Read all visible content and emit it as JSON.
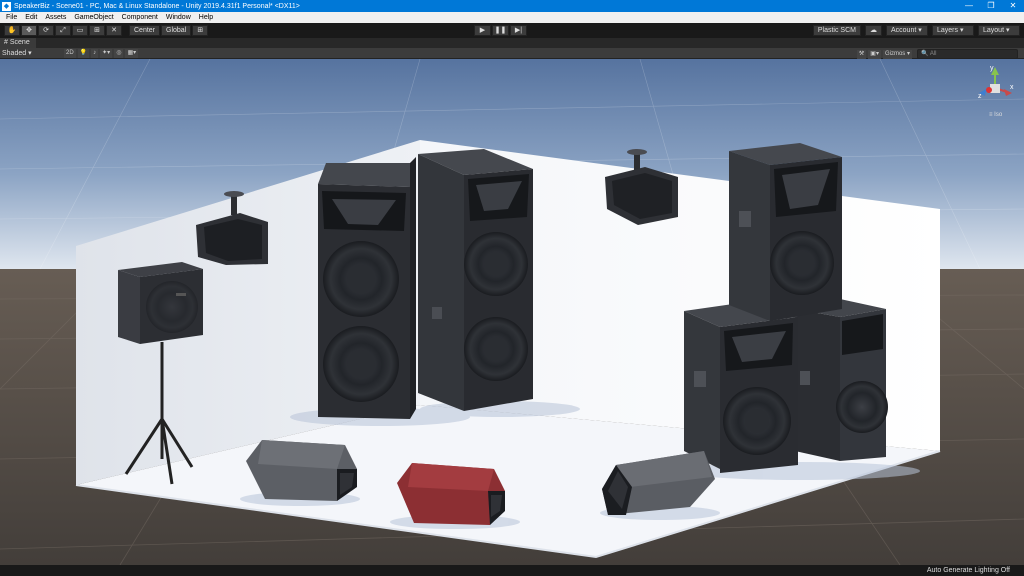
{
  "window": {
    "title": "SpeakerBiz - Scene01 - PC, Mac & Linux Standalone - Unity 2019.4.31f1 Personal* <DX11>",
    "controls": [
      "—",
      "❐",
      "✕"
    ]
  },
  "menu": [
    "File",
    "Edit",
    "Assets",
    "GameObject",
    "Component",
    "Window",
    "Help"
  ],
  "toolbar": {
    "tools": [
      "✋",
      "✥",
      "⟳",
      "⤢",
      "▭",
      "⊞",
      "✕"
    ],
    "pivot_label": "Center",
    "space_label": "Global",
    "play_controls": [
      "▶",
      "❚❚",
      "▶|"
    ],
    "plastic_label": "Plastic SCM",
    "account_label": "Account",
    "layers_label": "Layers",
    "layout_label": "Layout"
  },
  "scene_tab": {
    "label": "Scene"
  },
  "scene_toolbar": {
    "shading_mode": "Shaded",
    "mode_2d": "2D",
    "gizmos_label": "Gizmos",
    "search_placeholder": "All"
  },
  "gizmo": {
    "y": "y",
    "x": "x",
    "z": "z",
    "persp_label": "Iso"
  },
  "status": {
    "lighting": "Auto Generate Lighting Off"
  },
  "colors": {
    "titlebar": "#0078d7",
    "sky_top": "#5b7bab",
    "ground": "#4a4541",
    "speaker_body": "#2a2c30",
    "monitor_red": "#8c2f33"
  }
}
